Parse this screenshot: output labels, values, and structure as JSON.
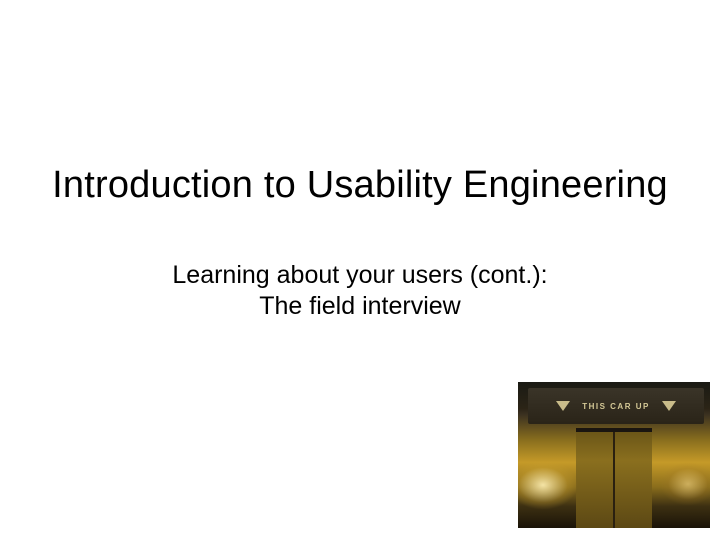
{
  "title": "Introduction to Usability Engineering",
  "subtitle_line1": "Learning about your users (cont.):",
  "subtitle_line2": "The field interview",
  "image": {
    "sign_text": "THIS CAR UP"
  }
}
